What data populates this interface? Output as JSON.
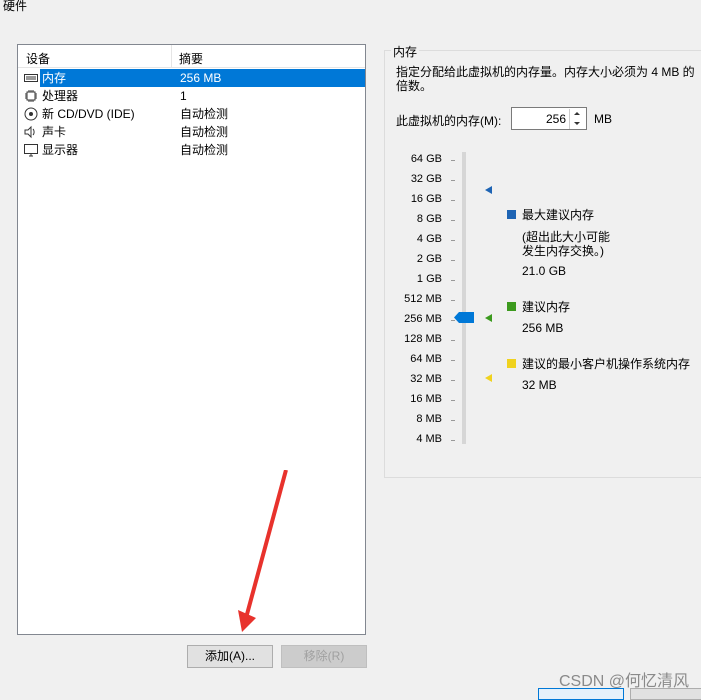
{
  "window_title": "硬件",
  "device_list": {
    "columns": {
      "device": "设备",
      "summary": "摘要"
    },
    "rows": [
      {
        "name": "内存",
        "summary": "256 MB",
        "icon": "memory-icon",
        "selected": true
      },
      {
        "name": "处理器",
        "summary": "1",
        "icon": "cpu-icon",
        "selected": false
      },
      {
        "name": "新 CD/DVD (IDE)",
        "summary": "自动检测",
        "icon": "cd-icon",
        "selected": false
      },
      {
        "name": "声卡",
        "summary": "自动检测",
        "icon": "speaker-icon",
        "selected": false
      },
      {
        "name": "显示器",
        "summary": "自动检测",
        "icon": "monitor-icon",
        "selected": false
      }
    ]
  },
  "buttons": {
    "add": "添加(A)...",
    "remove": "移除(R)"
  },
  "memory_panel": {
    "title": "内存",
    "description": "指定分配给此虚拟机的内存量。内存大小必须为 4 MB 的倍数。",
    "label": "此虚拟机的内存(M):",
    "value": "256",
    "unit": "MB",
    "scale": [
      "64 GB",
      "32 GB",
      "16 GB",
      "8 GB",
      "4 GB",
      "2 GB",
      "1 GB",
      "512 MB",
      "256 MB",
      "128 MB",
      "64 MB",
      "32 MB",
      "16 MB",
      "8 MB",
      "4 MB"
    ],
    "legend": {
      "max": {
        "title": "最大建议内存",
        "note_line1": "(超出此大小可能",
        "note_line2": "发生内存交换。)",
        "value": "21.0 GB",
        "color": "#1e64b4"
      },
      "recommended": {
        "title": "建议内存",
        "value": "256 MB",
        "color": "#3c9a1e"
      },
      "min": {
        "title": "建议的最小客户机操作系统内存",
        "value": "32 MB",
        "color": "#f0d21e"
      }
    }
  },
  "watermark": "CSDN @何忆清风"
}
